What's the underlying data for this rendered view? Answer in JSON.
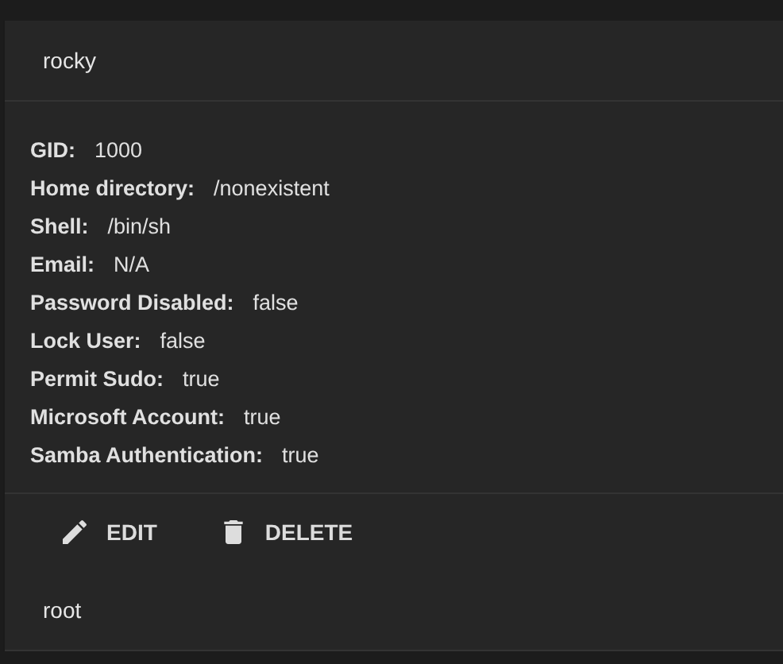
{
  "users": [
    {
      "name": "rocky",
      "details": [
        {
          "label": "GID:",
          "value": "1000"
        },
        {
          "label": "Home directory:",
          "value": "/nonexistent"
        },
        {
          "label": "Shell:",
          "value": "/bin/sh"
        },
        {
          "label": "Email:",
          "value": "N/A"
        },
        {
          "label": "Password Disabled:",
          "value": "false"
        },
        {
          "label": "Lock User:",
          "value": "false"
        },
        {
          "label": "Permit Sudo:",
          "value": "true"
        },
        {
          "label": "Microsoft Account:",
          "value": "true"
        },
        {
          "label": "Samba Authentication:",
          "value": "true"
        }
      ],
      "actions": [
        {
          "kind": "edit",
          "label": "EDIT"
        },
        {
          "kind": "delete",
          "label": "DELETE"
        }
      ]
    },
    {
      "name": "root"
    }
  ]
}
